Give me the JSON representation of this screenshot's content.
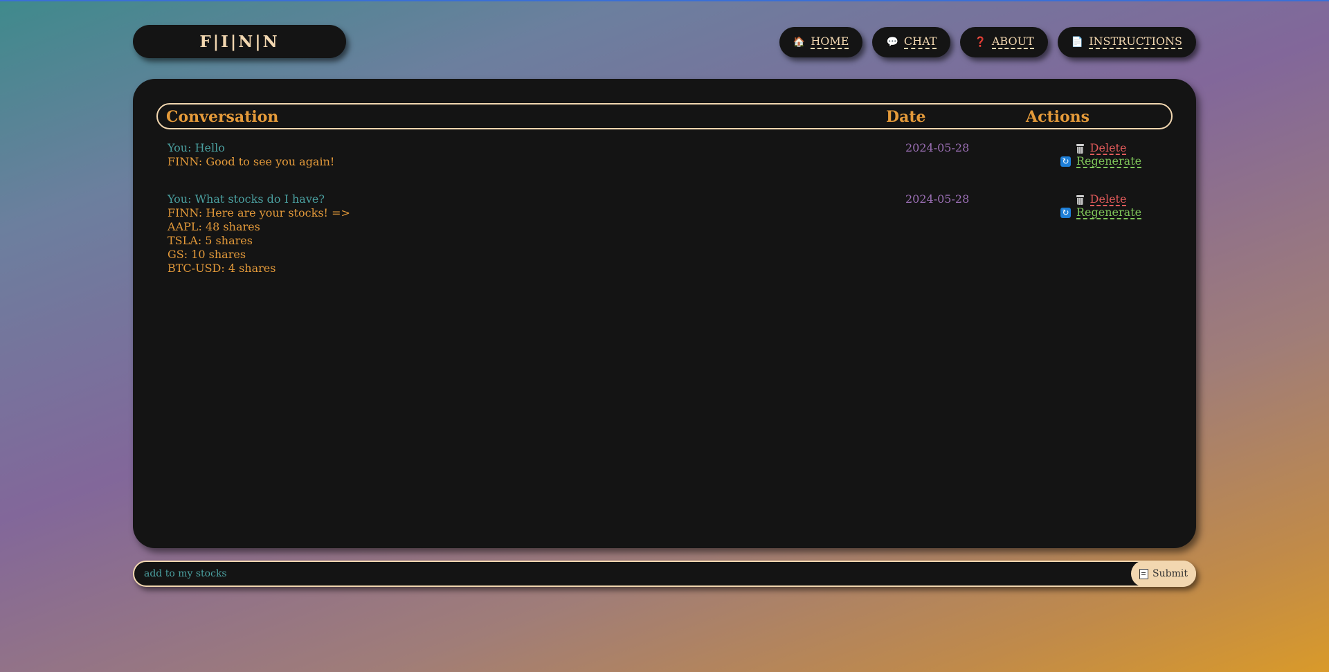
{
  "logo": {
    "text": "F|I|N|N"
  },
  "nav": [
    {
      "label": "HOME",
      "icon": "house-icon",
      "glyph": "🏠"
    },
    {
      "label": "CHAT",
      "icon": "speech-bubble-icon",
      "glyph": "💬"
    },
    {
      "label": "ABOUT",
      "icon": "question-mark-icon",
      "glyph": "❓"
    },
    {
      "label": "INSTRUCTIONS",
      "icon": "page-icon",
      "glyph": "📄"
    }
  ],
  "table": {
    "headers": {
      "conversation": "Conversation",
      "date": "Date",
      "actions": "Actions"
    },
    "rows": [
      {
        "user": "You: Hello",
        "finn": [
          "FINN: Good to see you again!"
        ],
        "date": "2024-05-28",
        "delete_label": "Delete",
        "regenerate_label": "Regenerate"
      },
      {
        "user": "You: What stocks do I have?",
        "finn": [
          "FINN: Here are your stocks! =>",
          "AAPL: 48 shares",
          "TSLA: 5 shares",
          "GS: 10 shares",
          "BTC-USD: 4 shares"
        ],
        "date": "2024-05-28",
        "delete_label": "Delete",
        "regenerate_label": "Regenerate"
      }
    ]
  },
  "chat_input": {
    "value": "add to my stocks"
  },
  "submit": {
    "label": "Submit",
    "icon": "memo-icon"
  },
  "colors": {
    "panel": "#141414",
    "accent_cream": "#f2d7b0",
    "header_orange": "#e49a3a",
    "user_teal": "#4a9f9f",
    "date_purple": "#9b6fb5",
    "delete_red": "#e05a5a",
    "regenerate_green": "#7fc65a"
  }
}
